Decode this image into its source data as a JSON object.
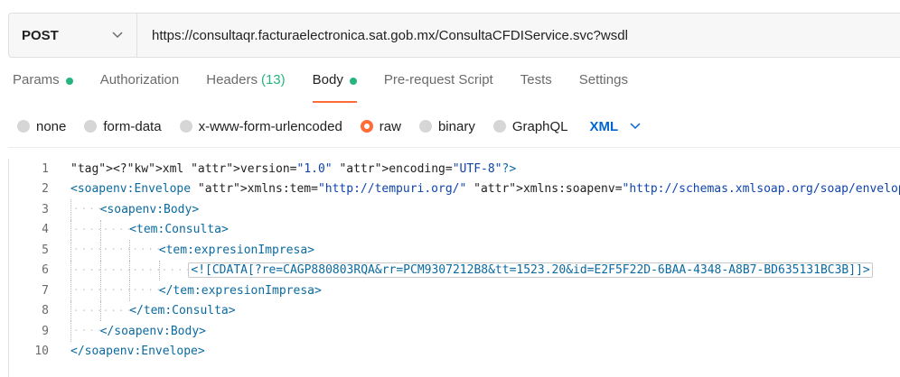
{
  "request": {
    "method": "POST",
    "url": "https://consultaqr.facturaelectronica.sat.gob.mx/ConsultaCFDIService.svc?wsdl"
  },
  "tabs": [
    {
      "label": "Params",
      "dot": true
    },
    {
      "label": "Authorization"
    },
    {
      "label": "Headers",
      "count": "(13)"
    },
    {
      "label": "Body",
      "dot": true,
      "active": true
    },
    {
      "label": "Pre-request Script"
    },
    {
      "label": "Tests"
    },
    {
      "label": "Settings"
    }
  ],
  "body_types": [
    {
      "label": "none",
      "checked": false
    },
    {
      "label": "form-data",
      "checked": false
    },
    {
      "label": "x-www-form-urlencoded",
      "checked": false
    },
    {
      "label": "raw",
      "checked": true
    },
    {
      "label": "binary",
      "checked": false
    },
    {
      "label": "GraphQL",
      "checked": false
    }
  ],
  "language": "XML",
  "editor": {
    "lines": [
      {
        "num": "1",
        "text": "<?xml version=\"1.0\" encoding=\"UTF-8\"?>"
      },
      {
        "num": "2",
        "text": "<soapenv:Envelope xmlns:tem=\"http://tempuri.org/\" xmlns:soapenv=\"http://schemas.xmlsoap.org/soap/envelope/\">"
      },
      {
        "num": "3",
        "text": "<soapenv:Body>"
      },
      {
        "num": "4",
        "text": "<tem:Consulta>"
      },
      {
        "num": "5",
        "text": "<tem:expresionImpresa>"
      },
      {
        "num": "6",
        "text": "<![CDATA[?re=CAGP880803RQA&rr=PCM9307212B8&tt=1523.20&id=E2F5F22D-6BAA-4348-A8B7-BD635131BC3B]]>"
      },
      {
        "num": "7",
        "text": "</tem:expresionImpresa>"
      },
      {
        "num": "8",
        "text": "</tem:Consulta>"
      },
      {
        "num": "9",
        "text": "</soapenv:Body>"
      },
      {
        "num": "10",
        "text": "</soapenv:Envelope>"
      }
    ]
  },
  "colors": {
    "accent": "#ff6c37",
    "status_dot": "#26b47f",
    "language": "#0265d2",
    "xml_tag": "#0b6aa0",
    "xml_attr": "#c0181c",
    "xml_string": "#0f44ad"
  }
}
